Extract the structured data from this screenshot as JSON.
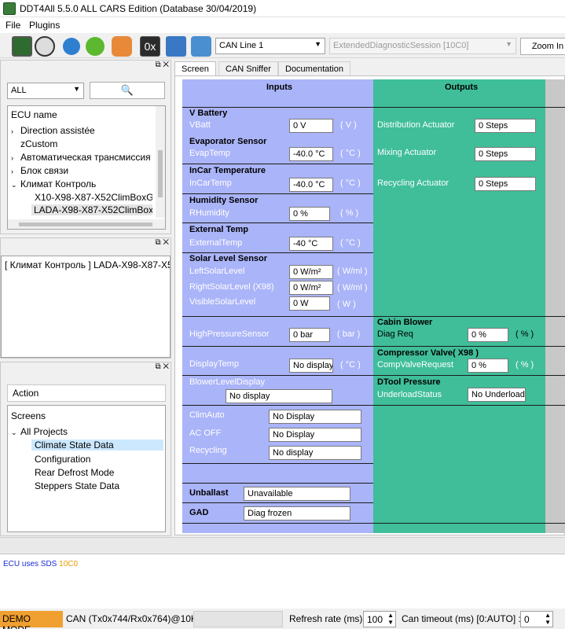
{
  "window": {
    "title": "DDT4All 5.5.0 ALL CARS Edition (Database 30/04/2019)"
  },
  "menu": {
    "file": "File",
    "plugins": "Plugins"
  },
  "toolbar": {
    "can_line": "CAN Line 1",
    "session": "ExtendedDiagnosticSession [10C0]",
    "zoom_in": "Zoom In",
    "hex_label": "0x"
  },
  "ecu_panel": {
    "filter": "ALL",
    "header": "ECU name",
    "items": [
      {
        "label": "Direction assistée",
        "arrow": ">"
      },
      {
        "label": "zCustom",
        "arrow": ""
      },
      {
        "label": "Автоматическая трансмиссия",
        "arrow": ">"
      },
      {
        "label": "Блок связи",
        "arrow": ">"
      },
      {
        "label": "Климат Контроль",
        "arrow": "v"
      },
      {
        "label": "X10-X98-X87-X52ClimBoxG",
        "arrow": ""
      },
      {
        "label": "LADA-X98-X87-X52ClimBox",
        "arrow": ""
      }
    ]
  },
  "info_panel": {
    "text": "[ Климат Контроль ] LADA-X98-X87-X5"
  },
  "screens_panel": {
    "action": "Action",
    "screens": "Screens",
    "all_projects": "All Projects",
    "items": [
      "Climate State Data",
      "Configuration",
      "Rear Defrost Mode",
      "Steppers State Data"
    ]
  },
  "tabs": [
    "Screen",
    "CAN Sniffer",
    "Documentation"
  ],
  "screen": {
    "inputs_header": "Inputs",
    "outputs_header": "Outputs",
    "vbattery": {
      "title": "V Battery",
      "label": "VBatt",
      "value": "0 V",
      "unit": "( V )"
    },
    "evap": {
      "title": "Evaporator Sensor",
      "label": "EvapTemp",
      "value": "-40.0 °C",
      "unit": "( °C )"
    },
    "incar": {
      "title": "InCar Temperature",
      "label": "InCarTemp",
      "value": "-40.0 °C",
      "unit": "( °C )"
    },
    "humidity": {
      "title": "Humidity Sensor",
      "label": "RHumidity",
      "value": "0 %",
      "unit": "( % )"
    },
    "external": {
      "title": "External Temp",
      "label": "ExternalTemp",
      "value": "-40 °C",
      "unit": "( °C )"
    },
    "solar": {
      "title": "Solar Level Sensor",
      "left_label": "LeftSolarLevel",
      "left_value": "0 W/m²",
      "left_unit": "( W/ml )",
      "right_label": "RightSolarLevel (X98)",
      "right_value": "0 W/m²",
      "right_unit": "( W/ml )",
      "visible_label": "VisibleSolarLevel",
      "visible_value": "0 W",
      "visible_unit": "( W )"
    },
    "highpressure": {
      "label": "HighPressureSensor",
      "value": "0 bar",
      "unit": "( bar )"
    },
    "displaytemp": {
      "label": "DisplayTemp",
      "value": "No display",
      "unit": "( °C )"
    },
    "blowerdisplay": {
      "label": "BlowerLevelDisplay",
      "value": "No display"
    },
    "climauto": {
      "label": "ClimAuto",
      "value": "No Display"
    },
    "acoff": {
      "label": "AC OFF",
      "value": "No Display"
    },
    "recycling": {
      "label": "Recycling",
      "value": "No display"
    },
    "unballast": {
      "label": "Unballast",
      "value": "Unavailable"
    },
    "gad": {
      "label": "GAD",
      "value": "Diag frozen"
    },
    "outputs": {
      "distribution": {
        "label": "Distribution Actuator",
        "value": "0 Steps"
      },
      "mixing": {
        "label": "Mixing Actuator",
        "value": "0 Steps"
      },
      "recycling": {
        "label": "Recycling Actuator",
        "value": "0 Steps"
      },
      "cabin": {
        "title": "Cabin Blower",
        "label": "Diag Req",
        "value": "0 %",
        "unit": "( % )"
      },
      "compressor": {
        "title": "Compressor Valve( X98 )",
        "label": "CompValveRequest",
        "value": "0 %",
        "unit": "( % )"
      },
      "dtool": {
        "title": "DTool Pressure",
        "label": "UnderloadStatus",
        "value": "No Underload"
      }
    }
  },
  "log": {
    "text": "ECU uses SDS",
    "code": "10C0"
  },
  "status": {
    "demo": "DEMO MODE",
    "can": "CAN (Tx0x744/Rx0x764)@10K",
    "refresh_label": "Refresh rate (ms):",
    "refresh_value": "100",
    "timeout_label": "Can timeout (ms) [0:AUTO] :",
    "timeout_value": "0"
  },
  "colors": {
    "inputs_bg": "#aab4f8",
    "outputs_bg": "#3fbe99",
    "demo_bg": "#f0a030"
  }
}
